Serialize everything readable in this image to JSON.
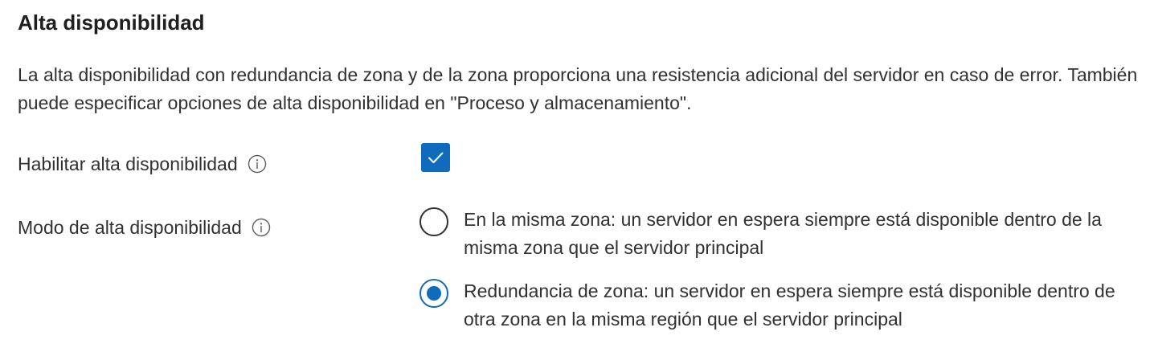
{
  "section": {
    "title": "Alta disponibilidad",
    "description": "La alta disponibilidad con redundancia de zona y de la zona proporciona una resistencia adicional del servidor en caso de error. También puede especificar opciones de alta disponibilidad en \"Proceso y almacenamiento\"."
  },
  "enable_high_availability": {
    "label": "Habilitar alta disponibilidad",
    "checked": true
  },
  "high_availability_mode": {
    "label": "Modo de alta disponibilidad",
    "options": [
      {
        "label": "En la misma zona: un servidor en espera siempre está disponible dentro de la misma zona que el servidor principal",
        "selected": false
      },
      {
        "label": "Redundancia de zona: un servidor en espera siempre está disponible dentro de otra zona en la misma región que el servidor principal",
        "selected": true
      }
    ]
  },
  "colors": {
    "accent": "#0f6cbd",
    "text": "#323130",
    "radio_border": "#323130"
  }
}
